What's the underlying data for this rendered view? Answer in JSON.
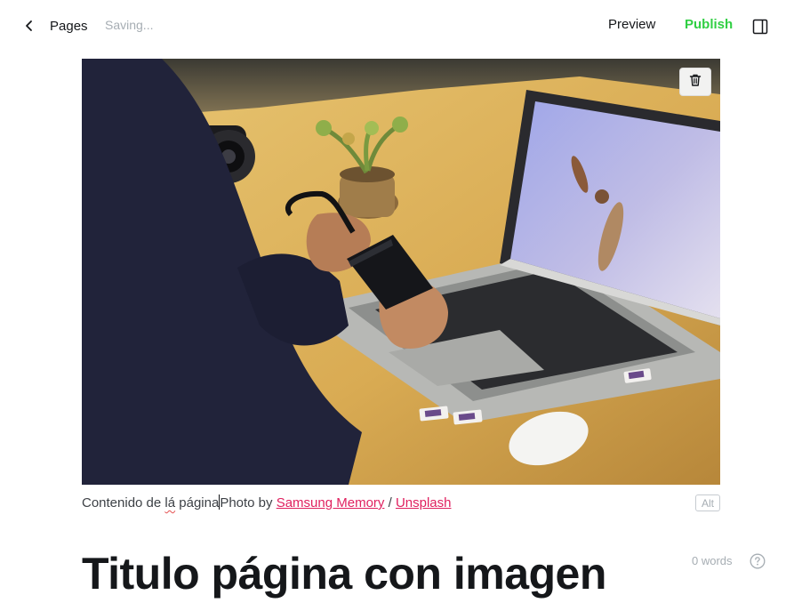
{
  "header": {
    "back_label": "Pages",
    "status": "Saving...",
    "preview_label": "Preview",
    "publish_label": "Publish"
  },
  "feature_image": {
    "alt_button_label": "Alt",
    "caption": {
      "text": "Contenido de ",
      "misspelled_word": "lá",
      "text_after": " página",
      "credit_prefix": "Photo by ",
      "author_link": "Samsung Memory",
      "separator": " / ",
      "source_link": "Unsplash"
    }
  },
  "post": {
    "title": "Titulo página con imagen",
    "word_count": "0 words"
  },
  "colors": {
    "publish_accent": "#30cf43",
    "link_accent": "#e0205f",
    "muted_text": "#a6adb3"
  },
  "icons": [
    "chevron-left-icon",
    "sidebar-panel-icon",
    "trash-icon",
    "help-circle-icon"
  ]
}
